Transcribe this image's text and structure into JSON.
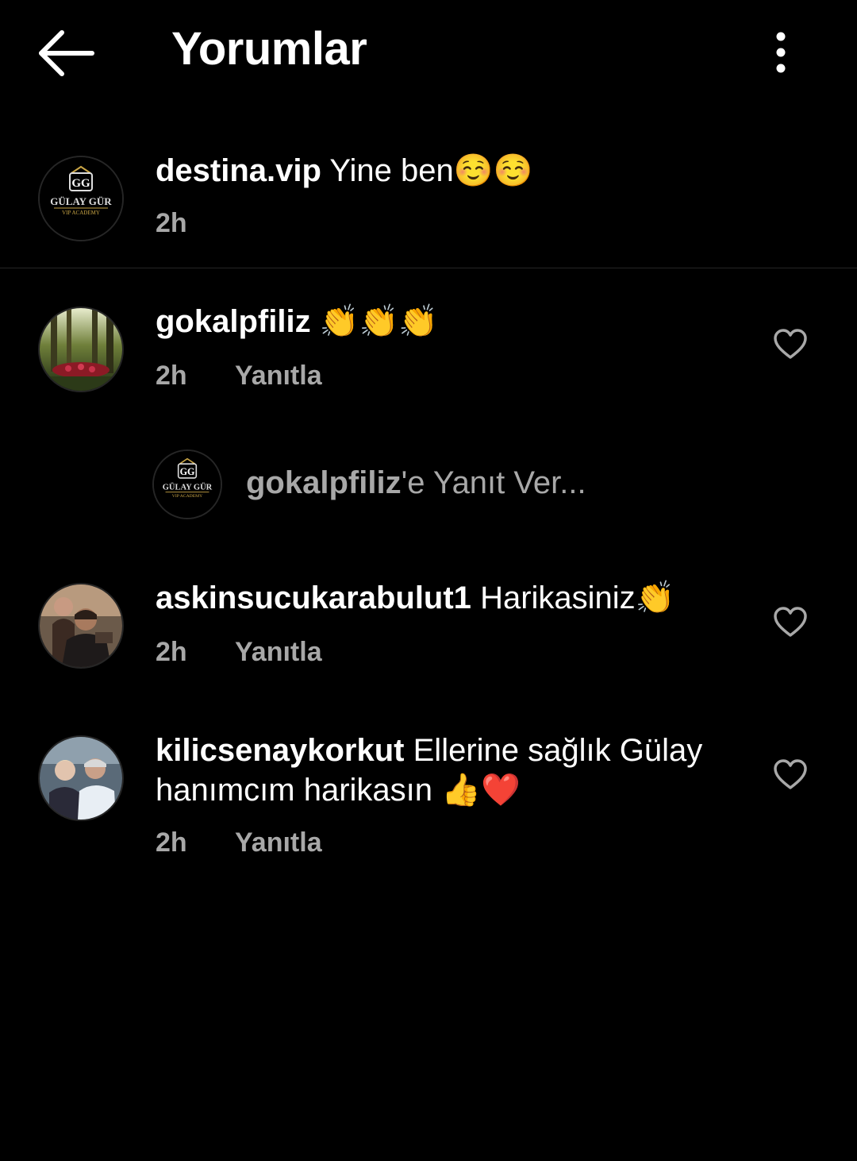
{
  "header": {
    "title": "Yorumlar"
  },
  "caption": {
    "username": "destina.vip",
    "text": "Yine ben☺️☺️",
    "time": "2h",
    "avatar_logo": {
      "top": "GG",
      "name": "GÜLAY GÜR",
      "sub": "VIP ACADEMY"
    }
  },
  "comments": [
    {
      "username": "gokalpfiliz",
      "text": "👏👏👏",
      "time": "2h",
      "reply_label": "Yanıtla"
    },
    {
      "username": "askinsucukarabulut1",
      "text": "Harikasiniz👏",
      "time": "2h",
      "reply_label": "Yanıtla"
    },
    {
      "username": "kilicsenaykorkut",
      "text_line1": "Ellerine sağlık Gülay",
      "text_line2": "hanımcım harikasın 👍❤️",
      "time": "2h",
      "reply_label": "Yanıtla"
    }
  ],
  "reply_box": {
    "target": "gokalpfiliz",
    "suffix": "'e Yanıt Ver..."
  },
  "colors": {
    "background": "#000000",
    "text": "#ffffff",
    "secondary": "#a8a8a8",
    "divider": "#262626",
    "logo_gold": "#c9a545"
  }
}
